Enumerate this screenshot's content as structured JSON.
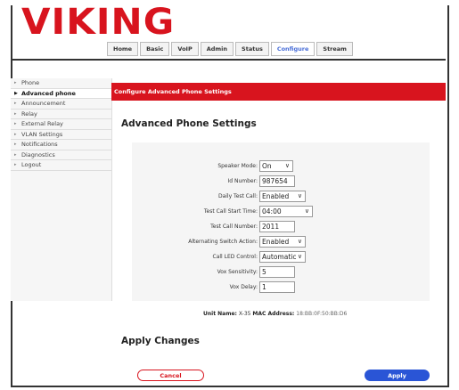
{
  "brand": {
    "logo": "VIKING",
    "accent": "#d8141e",
    "link": "#4a6fd8",
    "primary": "#2a55d6"
  },
  "tabs": [
    {
      "label": "Home",
      "active": false
    },
    {
      "label": "Basic",
      "active": false
    },
    {
      "label": "VoIP",
      "active": false
    },
    {
      "label": "Admin",
      "active": false
    },
    {
      "label": "Status",
      "active": false
    },
    {
      "label": "Configure",
      "active": true
    },
    {
      "label": "Stream",
      "active": false
    }
  ],
  "sidebar": {
    "items": [
      {
        "label": "Phone",
        "active": false
      },
      {
        "label": "Advanced phone",
        "active": true
      },
      {
        "label": "Announcement",
        "active": false
      },
      {
        "label": "Relay",
        "active": false
      },
      {
        "label": "External Relay",
        "active": false
      },
      {
        "label": "VLAN Settings",
        "active": false
      },
      {
        "label": "Notifications",
        "active": false
      },
      {
        "label": "Diagnostics",
        "active": false
      },
      {
        "label": "Logout",
        "active": false
      }
    ]
  },
  "header": {
    "banner": "Configure Advanced Phone Settings",
    "title": "Advanced Phone Settings"
  },
  "form": {
    "fields": [
      {
        "label": "Speaker Mode:",
        "value": "On",
        "type": "select"
      },
      {
        "label": "Id Number:",
        "value": "987654",
        "type": "text"
      },
      {
        "label": "Daily Test Call:",
        "value": "Enabled",
        "type": "select"
      },
      {
        "label": "Test Call Start Time:",
        "value": "04:00",
        "type": "select"
      },
      {
        "label": "Test Call Number:",
        "value": "2011",
        "type": "text"
      },
      {
        "label": "Alternating Switch Action:",
        "value": "Enabled",
        "type": "select"
      },
      {
        "label": "Call LED Control:",
        "value": "Automatic",
        "type": "select"
      },
      {
        "label": "Vox Sensitivity:",
        "value": "5",
        "type": "text"
      },
      {
        "label": "Vox Delay:",
        "value": "1",
        "type": "text"
      }
    ]
  },
  "unit": {
    "name_label": "Unit Name:",
    "name": "X-35",
    "mac_label": "MAC Address:",
    "mac": "18:BB:0F:50:BB:D6"
  },
  "apply_section": {
    "title": "Apply Changes"
  },
  "buttons": {
    "cancel": "Cancel",
    "apply": "Apply"
  }
}
